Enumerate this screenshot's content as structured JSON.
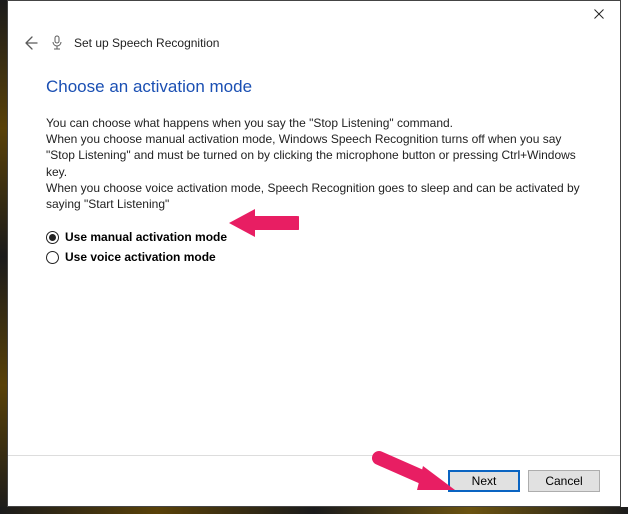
{
  "header": {
    "title": "Set up Speech Recognition"
  },
  "heading": "Choose an activation mode",
  "description": "You can choose what happens when you say the \"Stop Listening\" command.\nWhen you choose manual activation mode, Windows Speech Recognition turns off when you say \"Stop Listening\" and must be turned on by clicking the microphone button or pressing Ctrl+Windows key.\nWhen you choose voice activation mode, Speech Recognition goes to sleep and can be activated by saying \"Start Listening\"",
  "options": {
    "manual": {
      "label": "Use manual activation mode",
      "checked": true
    },
    "voice": {
      "label": "Use voice activation mode",
      "checked": false
    }
  },
  "footer": {
    "next": "Next",
    "cancel": "Cancel"
  }
}
